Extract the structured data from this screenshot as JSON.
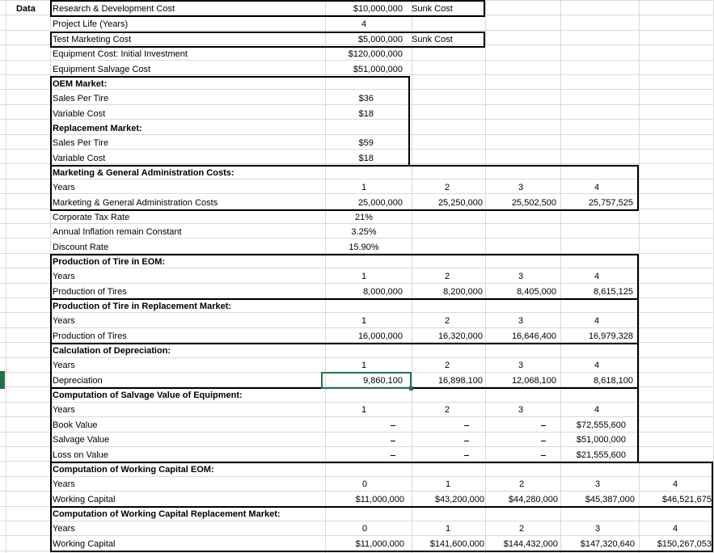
{
  "sheet": {
    "data_label": "Data",
    "rows": {
      "rd": {
        "label": "Research & Development Cost",
        "value": "$10,000,000",
        "note": "Sunk Cost"
      },
      "life": {
        "label": "Project Life (Years)",
        "value": "4"
      },
      "test": {
        "label": "Test Marketing Cost",
        "value": "$5,000,000",
        "note": "Sunk Cost"
      },
      "equip": {
        "label": "Equipment Cost: Initial Investment",
        "value": "$120,000,000"
      },
      "salv": {
        "label": "Equipment Salvage Cost",
        "value": "$51,000,000"
      },
      "oem_hdr": "OEM Market:",
      "oem_price": {
        "label": "Sales Per Tire",
        "value": "$36"
      },
      "oem_var": {
        "label": "Variable Cost",
        "value": "$18"
      },
      "rep_hdr": "Replacement Market:",
      "rep_price": {
        "label": "Sales Per Tire",
        "value": "$59"
      },
      "rep_var": {
        "label": "Variable Cost",
        "value": "$18"
      },
      "mga_hdr": "Marketing & General Administration Costs:",
      "mga_years": {
        "label": "Years",
        "values": [
          "1",
          "2",
          "3",
          "4"
        ]
      },
      "mga_costs": {
        "label": "Marketing & General Administration Costs",
        "values": [
          "25,000,000",
          "25,250,000",
          "25,502,500",
          "25,757,525"
        ]
      },
      "tax": {
        "label": "Corporate Tax Rate",
        "value": "21%"
      },
      "infl": {
        "label": "Annual Inflation remain Constant",
        "value": "3.25%"
      },
      "disc": {
        "label": "Discount Rate",
        "value": "15.90%"
      },
      "peom_hdr": "Production of Tire in EOM:",
      "peom_years": {
        "label": "Years",
        "values": [
          "1",
          "2",
          "3",
          "4"
        ]
      },
      "peom_prod": {
        "label": "Production of Tires",
        "values": [
          "8,000,000",
          "8,200,000",
          "8,405,000",
          "8,615,125"
        ]
      },
      "prep_hdr": "Production of Tire in Replacement Market:",
      "prep_years": {
        "label": "Years",
        "values": [
          "1",
          "2",
          "3",
          "4"
        ]
      },
      "prep_prod": {
        "label": "Production of Tires",
        "values": [
          "16,000,000",
          "16,320,000",
          "16,646,400",
          "16,979,328"
        ]
      },
      "dep_hdr": "Calculation of Depreciation:",
      "dep_years": {
        "label": "Years",
        "values": [
          "1",
          "2",
          "3",
          "4"
        ]
      },
      "dep_vals": {
        "label": "Depreciation",
        "values": [
          "9,860,100",
          "16,898,100",
          "12,068,100",
          "8,618,100"
        ]
      },
      "sv_hdr": "Computation of Salvage Value of Equipment:",
      "sv_years": {
        "label": "Years",
        "values": [
          "1",
          "2",
          "3",
          "4"
        ]
      },
      "sv_book": {
        "label": "Book Value",
        "value4": "$72,555,600"
      },
      "sv_salv": {
        "label": "Salvage Value",
        "value4": "$51,000,000"
      },
      "sv_loss": {
        "label": "Loss on Value",
        "value4": "$21,555,600"
      },
      "wc_hdr": "Computation of Working Capital EOM:",
      "wc_years": {
        "label": "Years",
        "values": [
          "0",
          "1",
          "2",
          "3",
          "4"
        ]
      },
      "wc_vals": {
        "label": "Working Capital",
        "values": [
          "$11,000,000",
          "$43,200,000",
          "$44,280,000",
          "$45,387,000",
          "$46,521,675"
        ]
      },
      "wr_hdr": "Computation of Working Capital Replacement Market:",
      "wr_years": {
        "label": "Years",
        "values": [
          "0",
          "1",
          "2",
          "3",
          "4"
        ]
      },
      "wr_vals": {
        "label": "Working Capital",
        "values": [
          "$11,000,000",
          "$141,600,000",
          "$144,432,000",
          "$147,320,640",
          "$150,267,053"
        ]
      }
    }
  }
}
